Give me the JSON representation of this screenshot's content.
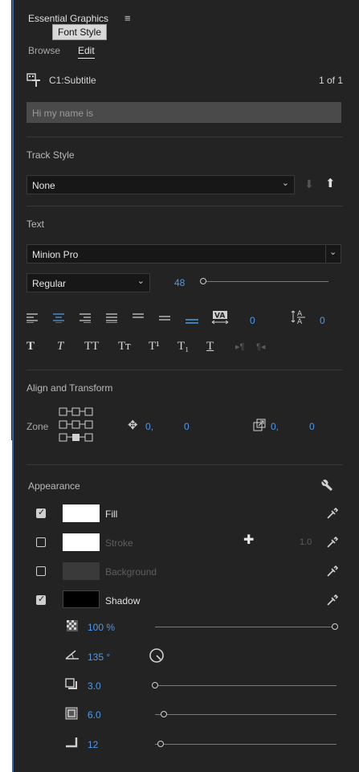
{
  "panel": {
    "title": "Essential Graphics",
    "menu_icon": "hamburger-icon",
    "tooltip": "Font Style",
    "tabs": [
      {
        "label": "Browse"
      },
      {
        "label": "Edit"
      }
    ],
    "active_tab": "Edit"
  },
  "layer": {
    "name": "C1:Subtitle",
    "count": "1 of 1",
    "text_value": "Hi my name is"
  },
  "track_style": {
    "label": "Track Style",
    "value": "None"
  },
  "text": {
    "label": "Text",
    "font": "Minion Pro",
    "style": "Regular",
    "size": "48",
    "size_fraction": 0.0,
    "tracking": "0",
    "leading": "0",
    "faux_buttons": [
      "T",
      "T",
      "TT",
      "Tт",
      "T¹",
      "T₁",
      "T"
    ]
  },
  "align_transform": {
    "label": "Align and Transform",
    "zone_label": "Zone",
    "pos_x": "0,",
    "pos_y": "0",
    "scale_x": "0,",
    "scale_y": "0"
  },
  "appearance": {
    "label": "Appearance",
    "rows": [
      {
        "label": "Fill",
        "checked": true,
        "color": "#ffffff"
      },
      {
        "label": "Stroke",
        "checked": false,
        "color": "#ffffff",
        "width": "1.0"
      },
      {
        "label": "Background",
        "checked": false,
        "color": "#3a3a3a"
      },
      {
        "label": "Shadow",
        "checked": true,
        "color": "#000000"
      }
    ],
    "shadow": {
      "opacity": "100 %",
      "angle": "135 °",
      "distance": "3.0",
      "size": "6.0",
      "blur": "12",
      "opacity_fraction": 1.0,
      "distance_fraction": 0.0,
      "size_fraction": 0.05,
      "blur_fraction": 0.03
    }
  },
  "colors": {
    "panel_bg": "#232323",
    "accent_blue": "#4d9ae8",
    "field_bg": "#171717",
    "left_border": "#3a67a8"
  }
}
